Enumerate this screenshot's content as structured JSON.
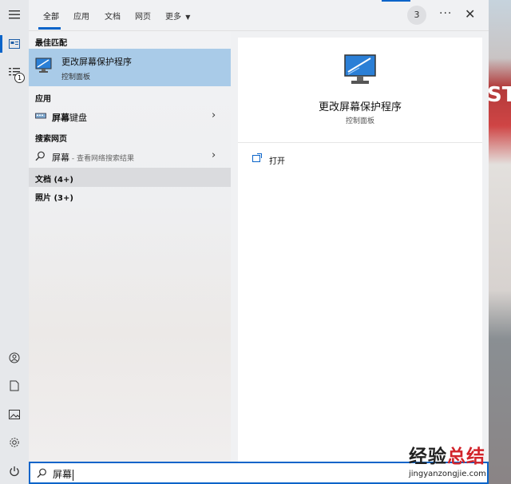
{
  "tabs": [
    {
      "label": "全部"
    },
    {
      "label": "应用"
    },
    {
      "label": "文档"
    },
    {
      "label": "网页"
    },
    {
      "label": "更多"
    }
  ],
  "header": {
    "counter": "3"
  },
  "results": {
    "best_match_heading": "最佳匹配",
    "best_match": {
      "title": "更改屏幕保护程序",
      "subtitle": "控制面板"
    },
    "apps_heading": "应用",
    "app_item": {
      "bold": "屏幕",
      "rest": "键盘"
    },
    "web_heading": "搜索网页",
    "web_item": {
      "label": "屏幕",
      "hint": " - 查看网络搜索结果"
    },
    "documents_group": "文档 (4+)",
    "photos_group": "照片 (3+)"
  },
  "detail": {
    "title": "更改屏幕保护程序",
    "subtitle": "控制面板",
    "open_label": "打开"
  },
  "rail": {
    "notification_count": "1"
  },
  "search": {
    "query": "屏幕"
  },
  "watermark": {
    "cn_black": "经验",
    "cn_red": "总结",
    "en": "jingyanzongjie.com"
  },
  "wallpaper_text": "ST",
  "colors": {
    "accent": "#0a64c9",
    "selected": "#a9cbe8"
  }
}
